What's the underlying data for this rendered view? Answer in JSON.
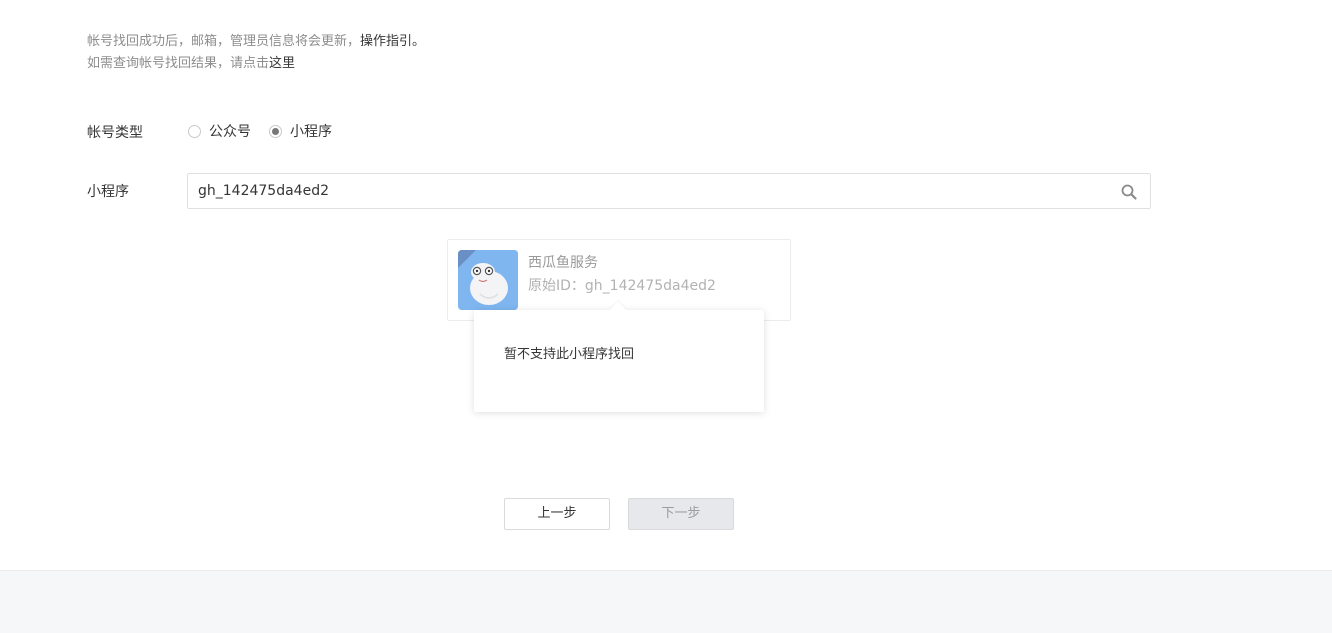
{
  "tips": {
    "line1_text": "帐号找回成功后，邮箱，管理员信息将会更新，",
    "line1_link": "操作指引。",
    "line2_text": "如需查询帐号找回结果，请点击",
    "line2_link": "这里"
  },
  "form": {
    "account_type_label": "帐号类型",
    "options": [
      {
        "label": "公众号",
        "selected": false
      },
      {
        "label": "小程序",
        "selected": true
      }
    ],
    "miniprogram_label": "小程序",
    "search_value": "gh_142475da4ed2",
    "search_icon": "search-icon"
  },
  "result": {
    "name": "西瓜鱼服务",
    "original_id": "原始ID：gh_142475da4ed2",
    "avatar_color": "#7fb6ef"
  },
  "popover": {
    "message": "暂不支持此小程序找回"
  },
  "buttons": {
    "prev_label": "上一步",
    "next_label": "下一步"
  },
  "colors": {
    "text": "#353535",
    "muted": "#8d8d8d",
    "footer_bg": "#f6f7f9"
  }
}
